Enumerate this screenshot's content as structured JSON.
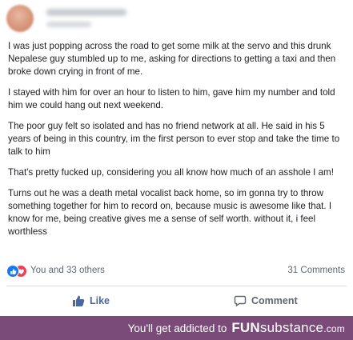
{
  "post": {
    "paragraphs": [
      "I was just popping across the road to get some milk at the servo and this drunk Nepalese guy stumbled up to me, asking for directions to getting a taxi and then broke down crying in front of me.",
      "I stayed with him for over an hour to listen to him, gave him my number and told him we could hang out next weekend.",
      "The poor guy felt so isolated and has no friend network at all. He said in his 5 years of being in this country, im the first person to ever stop and take the time to talk to him",
      "That's pretty fucked up, considering you all know how much of an asshole I am!",
      "Turns out he was a death metal vocalist back home, so im gonna try to throw something together for him to record on, because music is awesome like that. I know for me, being creative gives me a sense of self worth. without it, i feel worthless"
    ]
  },
  "reactions": {
    "text": "You and 33 others",
    "comments_count": "31 Comments",
    "icons": [
      "like-reaction-icon",
      "love-reaction-icon"
    ],
    "colors": {
      "like": "#1877f2",
      "love": "#f33e58"
    }
  },
  "actions": {
    "like_label": "Like",
    "comment_label": "Comment",
    "like_color": "#4b67a1"
  },
  "footer": {
    "prefix": "You'll get addicted to",
    "brand_fun": "FUN",
    "brand_sub": "substance",
    "brand_tld": ".com",
    "background": "#7a4a79"
  }
}
